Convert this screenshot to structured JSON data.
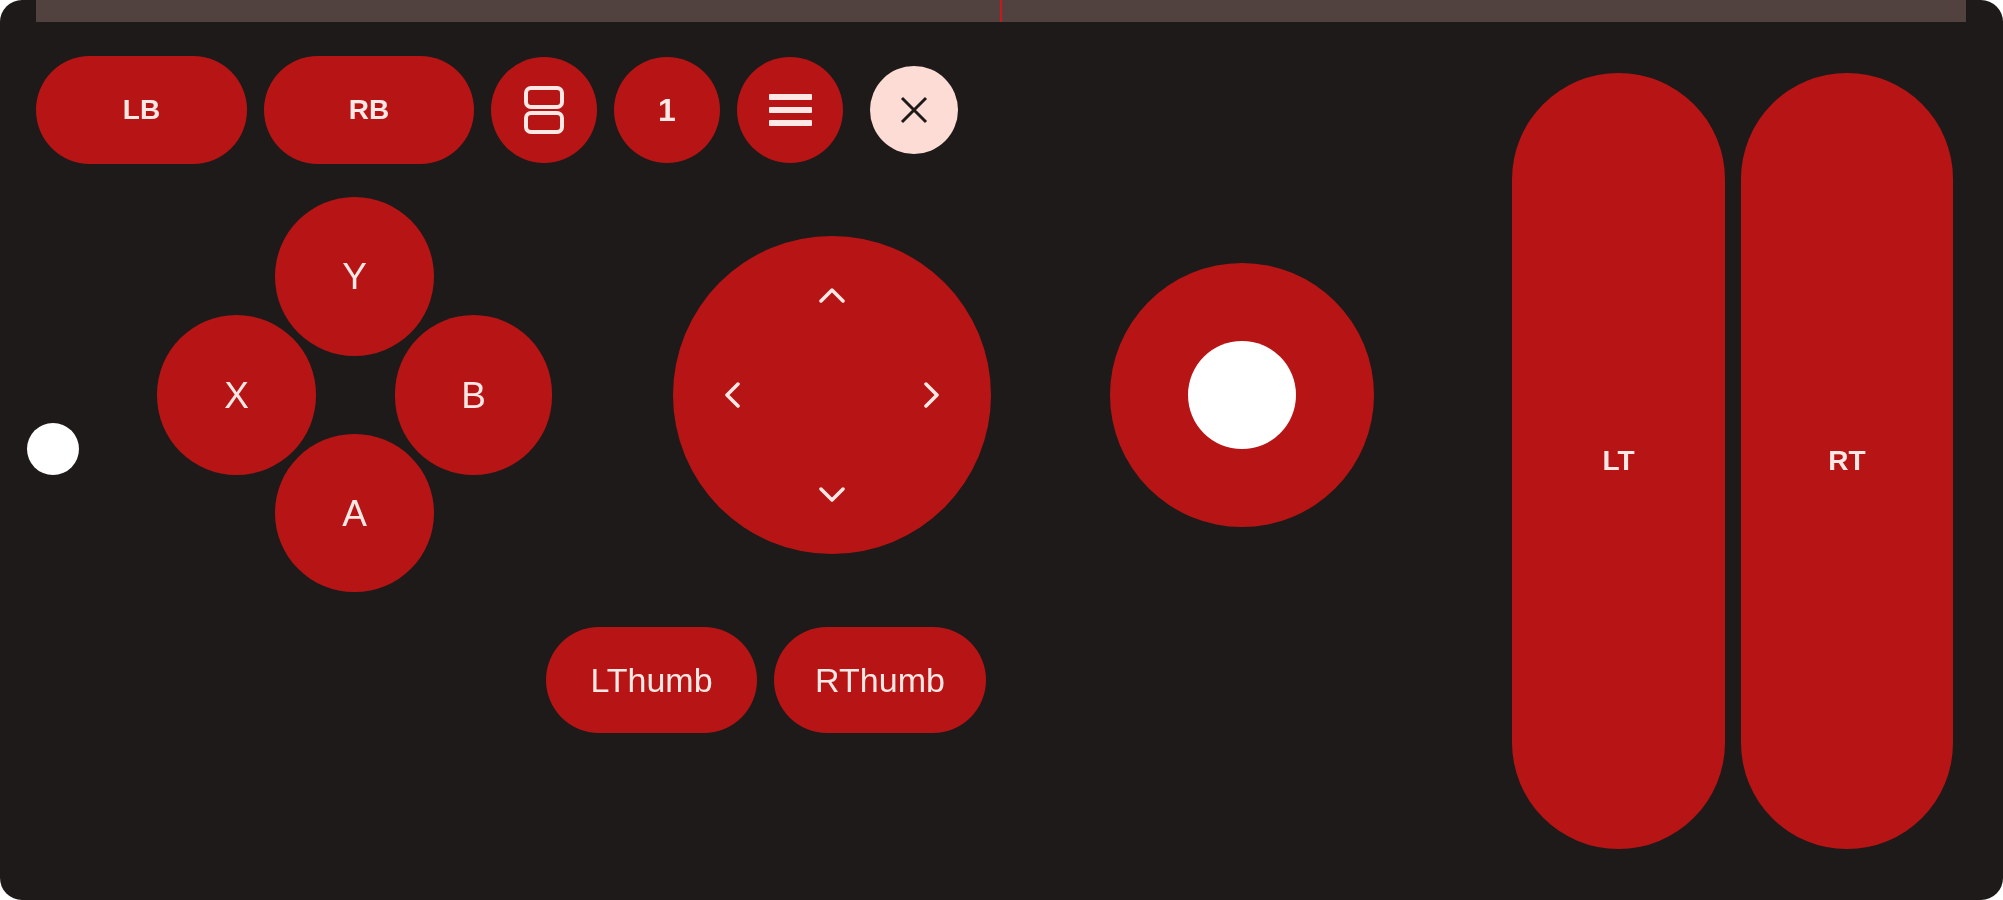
{
  "top_row": {
    "shoulder_buttons": [
      {
        "label": "LB"
      },
      {
        "label": "RB"
      }
    ],
    "number_button": {
      "label": "1"
    }
  },
  "face_buttons": [
    {
      "label": "Y"
    },
    {
      "label": "X"
    },
    {
      "label": "B"
    },
    {
      "label": "A"
    }
  ],
  "thumb_buttons": [
    {
      "label": "LThumb"
    },
    {
      "label": "RThumb"
    }
  ],
  "triggers": [
    {
      "label": "LT"
    },
    {
      "label": "RT"
    }
  ]
}
